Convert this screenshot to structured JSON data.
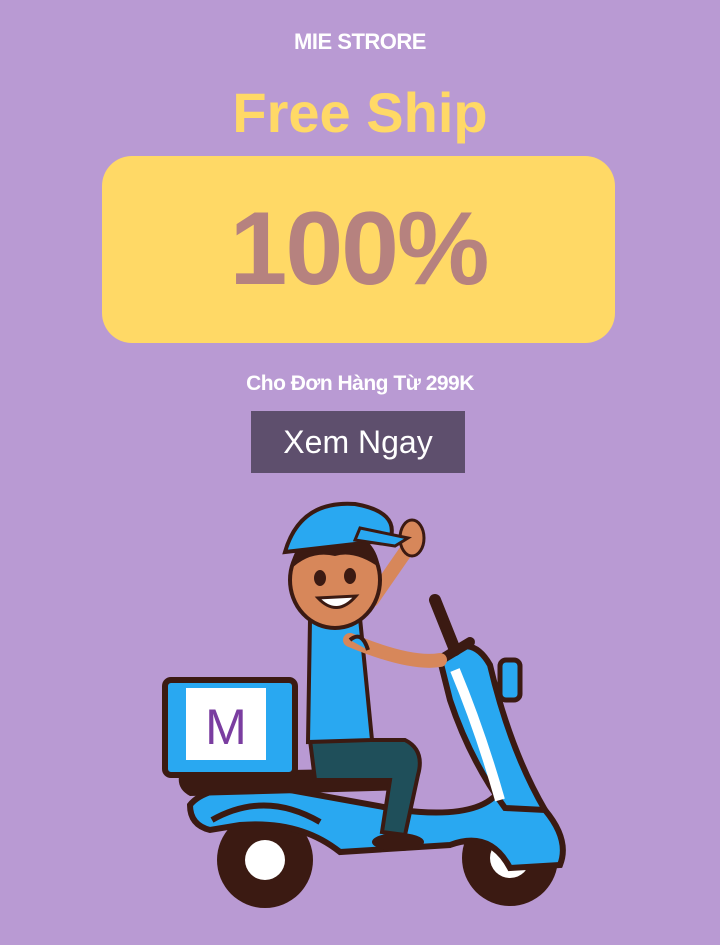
{
  "store": {
    "name": "MIE STRORE"
  },
  "promo": {
    "headline": "Free Ship",
    "discount": "100%",
    "condition": "Cho Đơn Hàng Từ 299K",
    "cta_label": "Xem Ngay"
  },
  "illustration": {
    "box_letter": "M"
  },
  "colors": {
    "background": "#b99ad3",
    "accent_yellow": "#ffd966",
    "discount_text": "#b6827f",
    "button": "#5e4f6d",
    "scooter_blue": "#29a8f1"
  }
}
